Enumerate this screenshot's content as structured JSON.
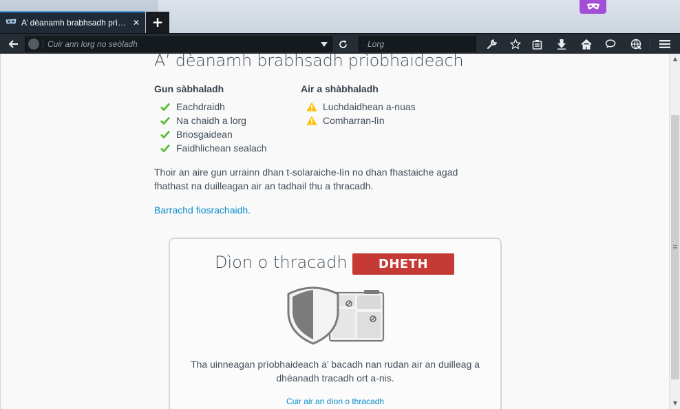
{
  "tab": {
    "title": "A’ dèanamh brabhsadh prìobhaideach",
    "close_glyph": "✕"
  },
  "toolbar": {
    "newtab_glyph": "+",
    "url_placeholder": "Cuir ann lorg no seòladh",
    "search_placeholder": "Lorg"
  },
  "page": {
    "heading": "A’ dèanamh brabhsadh prìobhaideach",
    "not_saved": {
      "title": "Gun sàbhaladh",
      "items": [
        "Eachdraidh",
        "Na chaidh a lorg",
        "Briosgaidean",
        "Faidhlichean sealach"
      ]
    },
    "saved": {
      "title": "Air a shàbhaladh",
      "items": [
        "Luchdaidhean a-nuas",
        "Comharran-lìn"
      ]
    },
    "notice": "Thoir an aire gun urrainn dhan t-solaraiche-lìn no dhan fhastaiche agad fhathast na duilleagan air an tadhail thu a thracadh.",
    "learn_more": "Barrachd fiosrachaidh.",
    "tracking": {
      "title": "Dìon o thracadh",
      "status": "DHETH",
      "description": "Tha uinneagan prìobhaideach a’ bacadh nan rudan air an duilleag a dhèanadh tracadh ort a-nis.",
      "link": "Cuir air an dìon o thracadh"
    }
  },
  "colors": {
    "check": "#57bd35",
    "warning": "#ffbf00",
    "toggle_off": "#c53a34",
    "link": "#0a8dc7",
    "private_badge": "#a24fd6"
  }
}
